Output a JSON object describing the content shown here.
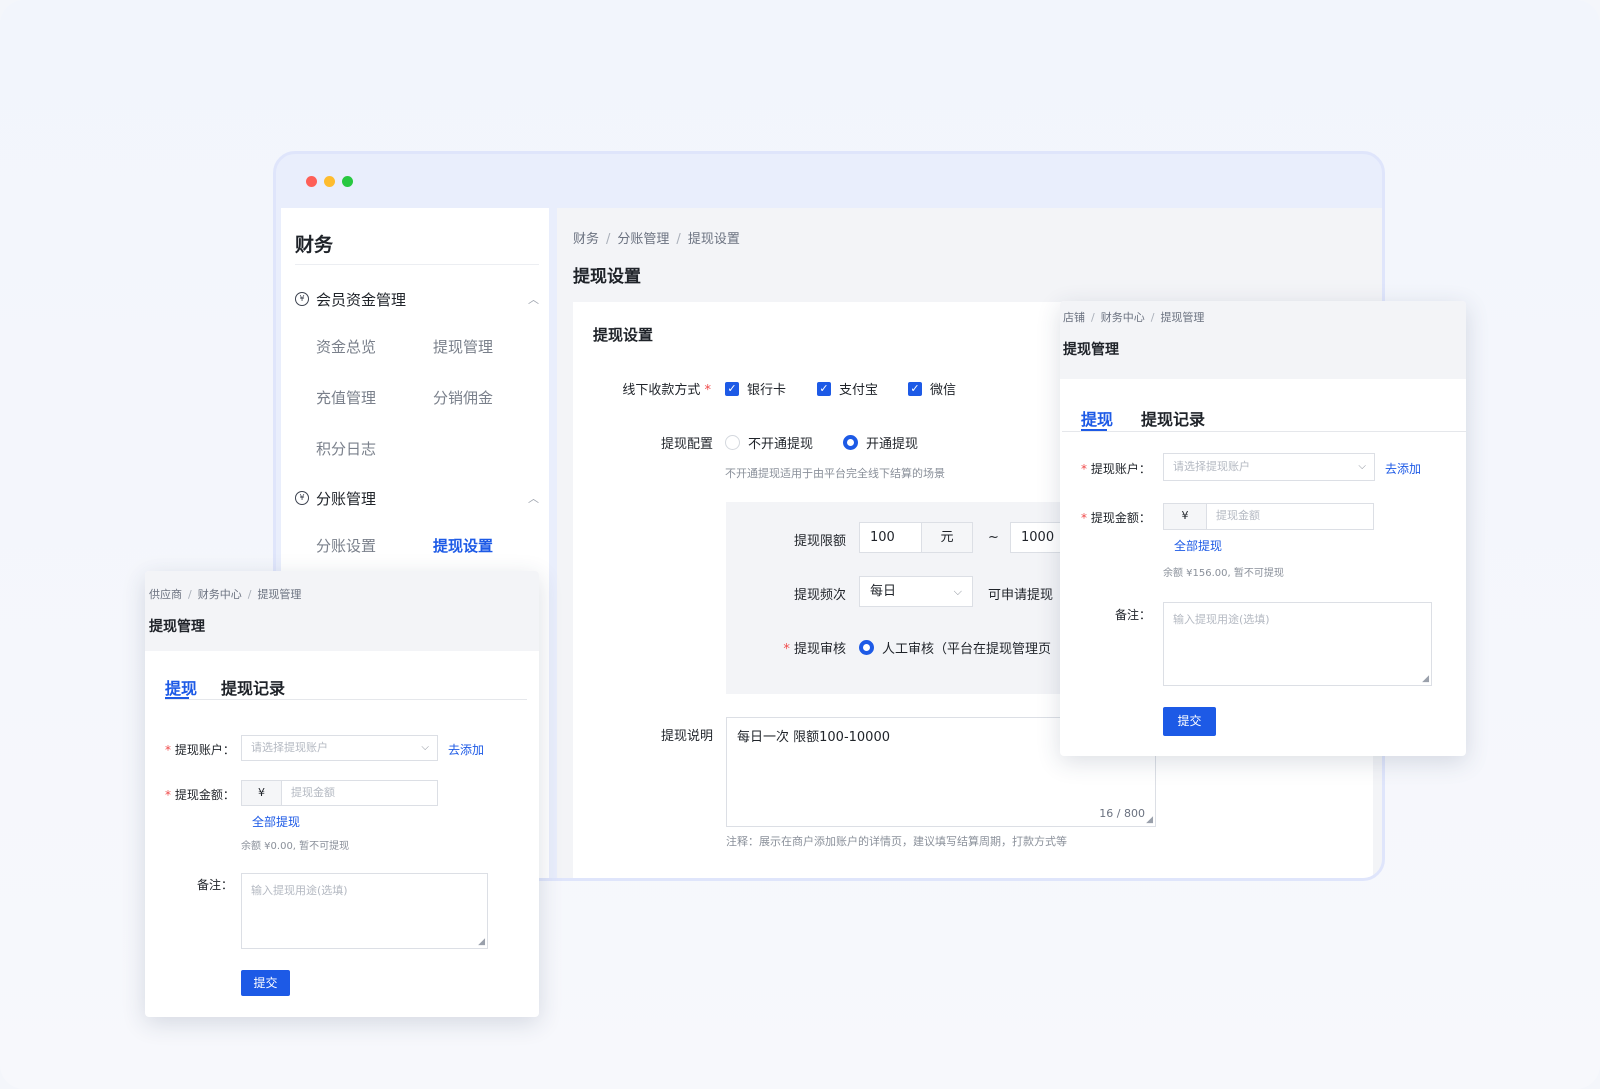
{
  "sidebar": {
    "title": "财务",
    "group1": {
      "label": "会员资金管理",
      "icon": "currency-circle-icon",
      "chevron": "︿"
    },
    "group1_items": [
      "资金总览",
      "提现管理",
      "充值管理",
      "分销佣金",
      "积分日志"
    ],
    "group2": {
      "label": "分账管理",
      "icon": "currency-refresh-icon",
      "chevron": "︿"
    },
    "group2_items": [
      "分账设置",
      "提现设置"
    ],
    "active_item": "提现设置"
  },
  "main": {
    "breadcrumb": [
      "财务",
      "分账管理",
      "提现设置"
    ],
    "page_title": "提现设置",
    "card_title": "提现设置",
    "payment_method": {
      "label": "线下收款方式",
      "required_mark": "*",
      "options": [
        {
          "label": "银行卡",
          "checked": true
        },
        {
          "label": "支付宝",
          "checked": true
        },
        {
          "label": "微信",
          "checked": true
        }
      ]
    },
    "withdraw_config": {
      "label": "提现配置",
      "options": [
        {
          "label": "不开通提现",
          "selected": false
        },
        {
          "label": "开通提现",
          "selected": true
        }
      ],
      "hint": "不开通提现适用于由平台完全线下结算的场景"
    },
    "limit": {
      "label": "提现限额",
      "min": "100",
      "unit": "元",
      "tilde": "~",
      "max": "1000"
    },
    "frequency": {
      "label": "提现频次",
      "value": "每日",
      "suffix": "可申请提现"
    },
    "review": {
      "label": "提现审核",
      "required_mark": "*",
      "option": "人工审核（平台在提现管理页"
    },
    "description": {
      "label": "提现说明",
      "value": "每日一次 限额100-10000",
      "counter": "16 / 800",
      "note": "注释：展示在商户添加账户的详情页，建议填写结算周期，打款方式等"
    }
  },
  "dialog_store": {
    "breadcrumb": [
      "店铺",
      "财务中心",
      "提现管理"
    ],
    "title": "提现管理",
    "tabs": [
      "提现",
      "提现记录"
    ],
    "account_label": "提现账户：",
    "account_placeholder": "请选择提现账户",
    "add_link": "去添加",
    "amount_label": "提现金额：",
    "currency": "¥",
    "amount_placeholder": "提现金额",
    "withdraw_all": "全部提现",
    "balance_hint": "余额 ¥156.00, 暂不可提现",
    "remark_label": "备注：",
    "remark_placeholder": "输入提现用途(选填)",
    "submit": "提交"
  },
  "dialog_supplier": {
    "breadcrumb": [
      "供应商",
      "财务中心",
      "提现管理"
    ],
    "title": "提现管理",
    "tabs": [
      "提现",
      "提现记录"
    ],
    "account_label": "提现账户：",
    "account_placeholder": "请选择提现账户",
    "add_link": "去添加",
    "amount_label": "提现金额：",
    "currency": "¥",
    "amount_placeholder": "提现金额",
    "withdraw_all": "全部提现",
    "balance_hint": "余额 ¥0.00, 暂不可提现",
    "remark_label": "备注：",
    "remark_placeholder": "输入提现用途(选填)",
    "submit": "提交"
  },
  "colors": {
    "accent": "#1d5ae6",
    "required": "#f04a4a",
    "window_frame": "#e9eefc"
  }
}
